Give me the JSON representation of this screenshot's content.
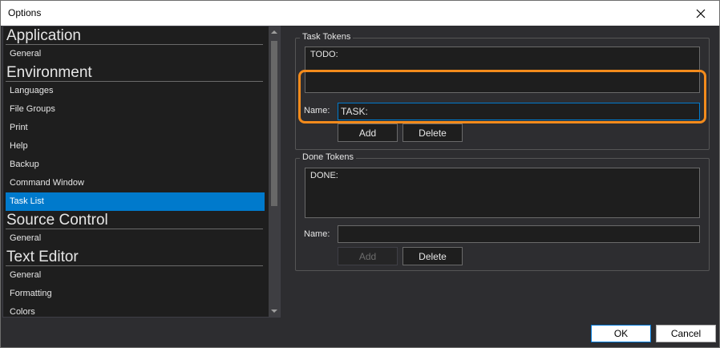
{
  "window": {
    "title": "Options"
  },
  "tree": {
    "sections": [
      {
        "header": "Application",
        "items": [
          "General"
        ]
      },
      {
        "header": "Environment",
        "items": [
          "Languages",
          "File Groups",
          "Print",
          "Help",
          "Backup",
          "Command Window",
          "Task List"
        ]
      },
      {
        "header": "Source Control",
        "items": [
          "General"
        ]
      },
      {
        "header": "Text Editor",
        "items": [
          "General",
          "Formatting",
          "Colors"
        ]
      }
    ],
    "selected": "Task List"
  },
  "task_tokens": {
    "legend": "Task Tokens",
    "list": [
      "TODO:"
    ],
    "name_label": "Name:",
    "name_value": "TASK:",
    "add_label": "Add",
    "delete_label": "Delete"
  },
  "done_tokens": {
    "legend": "Done Tokens",
    "list": [
      "DONE:"
    ],
    "name_label": "Name:",
    "name_value": "",
    "add_label": "Add",
    "delete_label": "Delete"
  },
  "footer": {
    "ok_label": "OK",
    "cancel_label": "Cancel"
  },
  "colors": {
    "accent": "#007acc",
    "highlight": "#f38b1c",
    "background": "#2d2d30",
    "panel": "#1e1e1e"
  }
}
